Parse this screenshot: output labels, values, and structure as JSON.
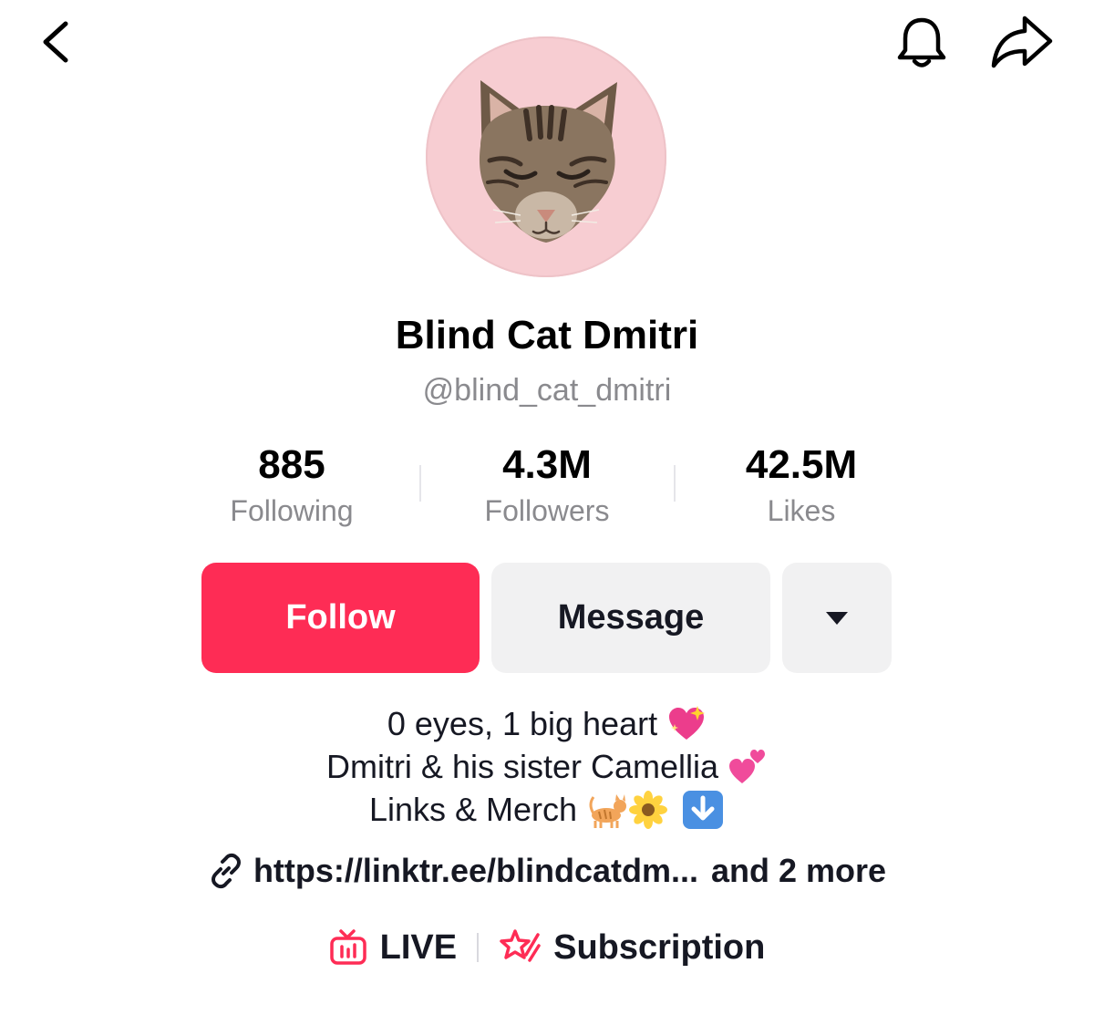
{
  "profile": {
    "display_name": "Blind Cat Dmitri",
    "handle": "@blind_cat_dmitri",
    "avatar_bg": "#f7cdd2"
  },
  "stats": [
    {
      "value": "885",
      "label": "Following"
    },
    {
      "value": "4.3M",
      "label": "Followers"
    },
    {
      "value": "42.5M",
      "label": "Likes"
    }
  ],
  "actions": {
    "follow_label": "Follow",
    "message_label": "Message",
    "more_icon": "caret-down-icon",
    "follow_color": "#fe2c55"
  },
  "bio": {
    "lines": [
      {
        "text": "0 eyes, 1 big heart",
        "emoji": "sparkling-heart-emoji"
      },
      {
        "text": "Dmitri & his sister Camellia",
        "emoji": "two-hearts-emoji"
      },
      {
        "text": "Links & Merch",
        "emoji": "cat-sunflower-down-arrow-emoji"
      }
    ]
  },
  "link": {
    "url_text": "https://linktr.ee/blindcatdm...",
    "more_text": "and 2 more"
  },
  "features": {
    "live_label": "LIVE",
    "subscription_label": "Subscription"
  },
  "nav": {
    "back_icon": "chevron-left-icon",
    "notification_icon": "bell-icon",
    "share_icon": "share-arrow-icon"
  }
}
